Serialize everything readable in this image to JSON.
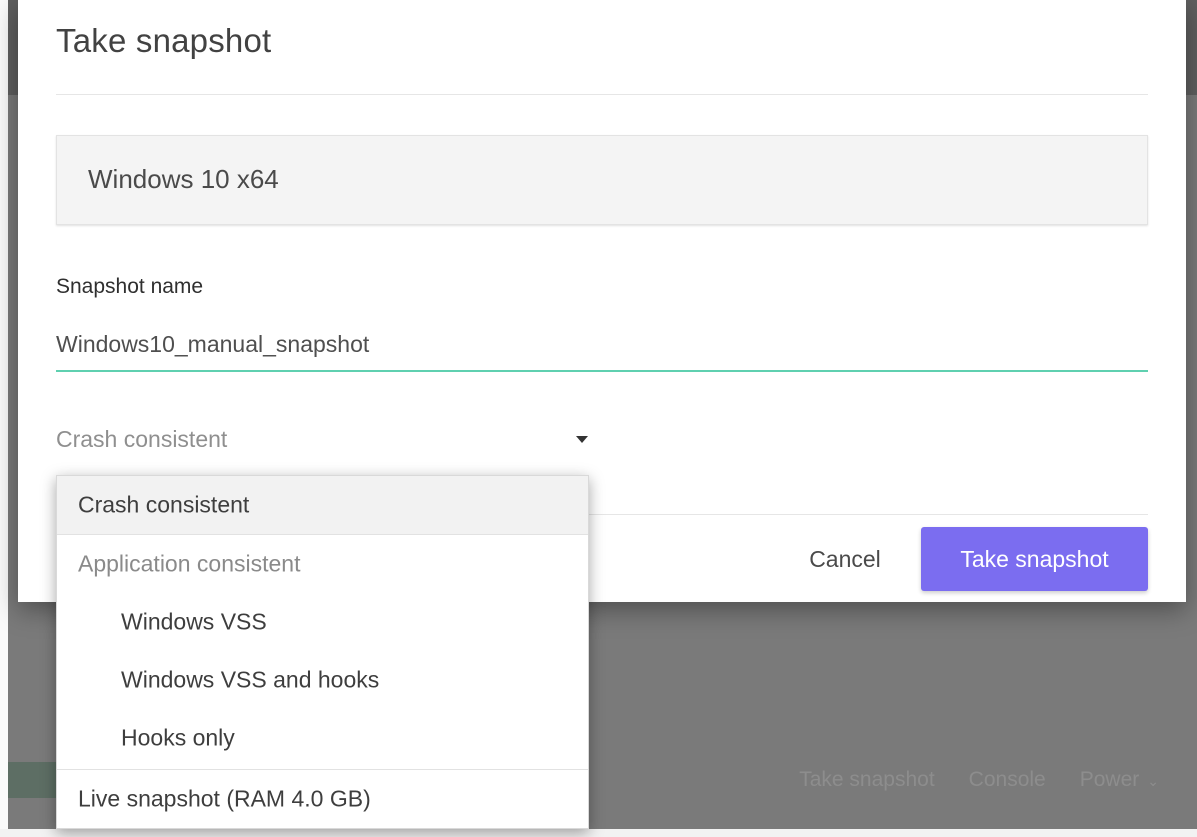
{
  "dialog": {
    "title": "Take snapshot",
    "vm_name": "Windows 10 x64",
    "snapshot_name_label": "Snapshot name",
    "snapshot_name_value": "Windows10_manual_snapshot",
    "consistency_select": {
      "selected": "Crash consistent"
    },
    "cancel_label": "Cancel",
    "submit_label": "Take snapshot"
  },
  "dropdown": {
    "items": [
      {
        "label": "Crash consistent",
        "selected": true
      },
      {
        "label": "Application consistent",
        "group_header": true
      },
      {
        "label": "Windows VSS"
      },
      {
        "label": "Windows VSS and hooks"
      },
      {
        "label": "Hooks only"
      },
      {
        "label": "Live snapshot (RAM 4.0 GB)"
      }
    ]
  },
  "background": {
    "toolbar": {
      "take_snapshot": "Take snapshot",
      "console": "Console",
      "power": "Power"
    }
  },
  "colors": {
    "accent_primary": "#7b6df0",
    "input_underline": "#5fd0b0",
    "overlay": "#7a7a7a"
  },
  "icons": {
    "select_caret": "caret-down-icon",
    "power_caret": "chevron-down-icon"
  }
}
